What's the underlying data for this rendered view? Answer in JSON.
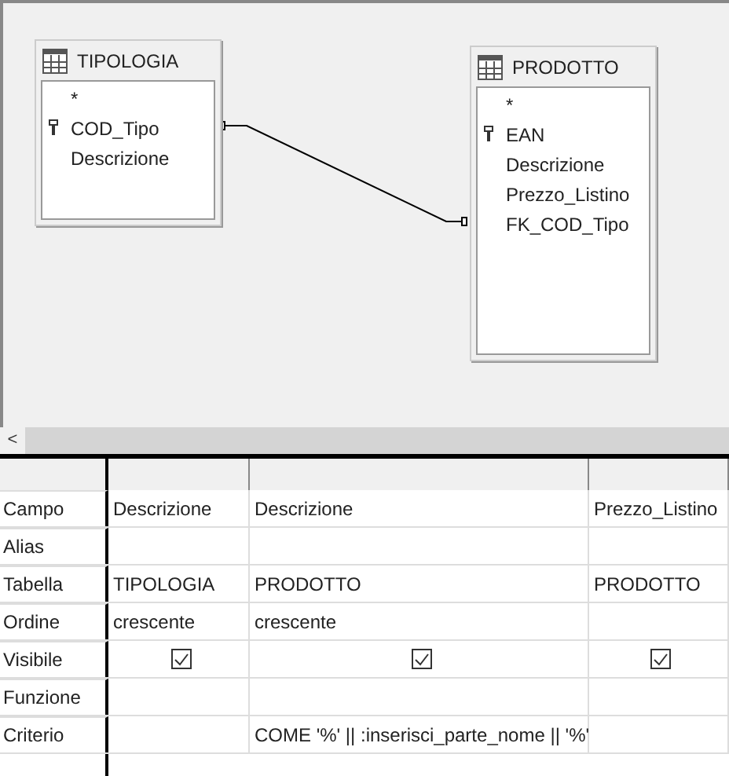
{
  "diagram": {
    "tables": [
      {
        "title": "TIPOLOGIA",
        "fields": [
          {
            "name": "*",
            "key": false
          },
          {
            "name": "COD_Tipo",
            "key": true
          },
          {
            "name": "Descrizione",
            "key": false
          }
        ]
      },
      {
        "title": "PRODOTTO",
        "fields": [
          {
            "name": "*",
            "key": false
          },
          {
            "name": "EAN",
            "key": true
          },
          {
            "name": "Descrizione",
            "key": false
          },
          {
            "name": "Prezzo_Listino",
            "key": false
          },
          {
            "name": "FK_COD_Tipo",
            "key": false
          }
        ]
      }
    ]
  },
  "scroll_left": "<",
  "grid": {
    "rows": [
      {
        "label": "Campo",
        "kind": "text",
        "cells": [
          "Descrizione",
          "Descrizione",
          "Prezzo_Listino"
        ]
      },
      {
        "label": "Alias",
        "kind": "text",
        "cells": [
          null,
          null,
          null
        ]
      },
      {
        "label": "Tabella",
        "kind": "text",
        "cells": [
          "TIPOLOGIA",
          "PRODOTTO",
          "PRODOTTO"
        ]
      },
      {
        "label": "Ordine",
        "kind": "text",
        "cells": [
          "crescente",
          "crescente",
          null
        ]
      },
      {
        "label": "Visibile",
        "kind": "checkbox",
        "cells": [
          {
            "checked": true
          },
          {
            "checked": true
          },
          {
            "checked": true
          }
        ]
      },
      {
        "label": "Funzione",
        "kind": "text",
        "cells": [
          null,
          null,
          null
        ]
      },
      {
        "label": "Criterio",
        "kind": "text",
        "cells": [
          null,
          "COME '%' || :inserisci_parte_nome || '%'",
          null
        ]
      }
    ]
  }
}
